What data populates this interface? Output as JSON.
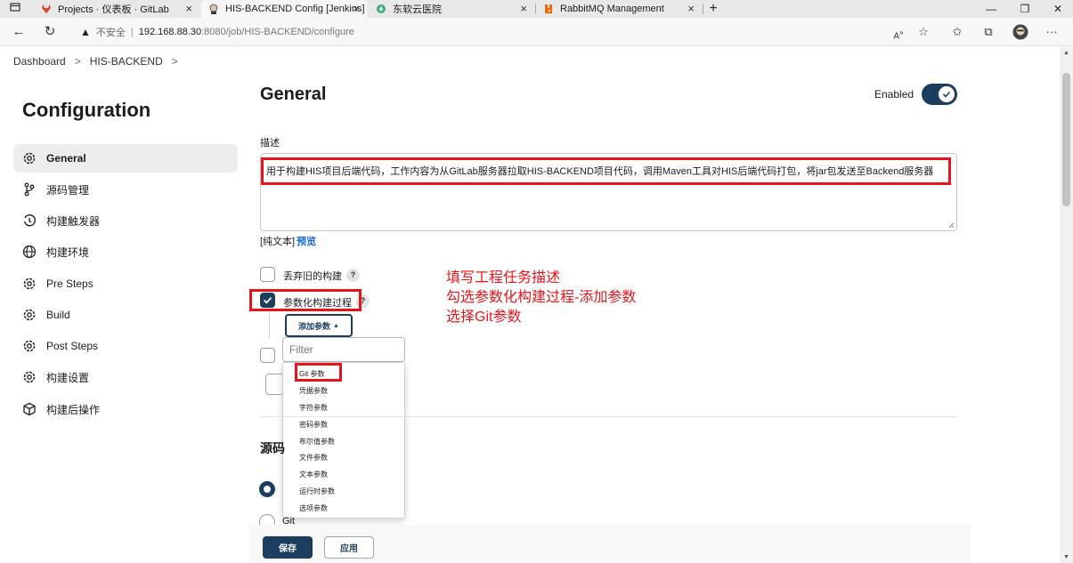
{
  "browser": {
    "tabs": [
      {
        "title": "Projects · 仪表板 · GitLab"
      },
      {
        "title": "HIS-BACKEND Config [Jenkins]"
      },
      {
        "title": "东软云医院"
      },
      {
        "title": "RabbitMQ Management"
      }
    ],
    "new_tab": "+",
    "window_controls": {
      "minimize": "—",
      "restore": "❐",
      "close": "✕"
    },
    "address": {
      "security_label": "不安全",
      "separator": "|",
      "host": "192.168.88.30",
      "path": ":8080/job/HIS-BACKEND/configure"
    }
  },
  "breadcrumb": {
    "items": [
      "Dashboard",
      "HIS-BACKEND"
    ],
    "chevron": ">"
  },
  "sidebar": {
    "title": "Configuration",
    "items": [
      {
        "label": "General",
        "icon": "gear-icon"
      },
      {
        "label": "源码管理",
        "icon": "branch-icon"
      },
      {
        "label": "构建触发器",
        "icon": "clock-icon"
      },
      {
        "label": "构建环境",
        "icon": "globe-icon"
      },
      {
        "label": "Pre Steps",
        "icon": "gear-icon"
      },
      {
        "label": "Build",
        "icon": "gear-icon"
      },
      {
        "label": "Post Steps",
        "icon": "gear-icon"
      },
      {
        "label": "构建设置",
        "icon": "gear-icon"
      },
      {
        "label": "构建后操作",
        "icon": "cube-icon"
      }
    ]
  },
  "main": {
    "title": "General",
    "enabled_label": "Enabled",
    "enabled": true,
    "description_label": "描述",
    "description_value": "用于构建HIS项目后端代码，工作内容为从GitLab服务器拉取HIS-BACKEND项目代码，调用Maven工具对HIS后端代码打包，将jar包发送至Backend服务器",
    "plain_text": "[纯文本]",
    "preview": "预览",
    "discard_old_builds": {
      "label": "丢弃旧的构建",
      "checked": false
    },
    "parameterized": {
      "label": "参数化构建过程",
      "checked": true
    },
    "help": "?",
    "add_param_button": "添加参数",
    "filter_placeholder": "Filter",
    "param_types": [
      "Git 参数",
      "凭据参数",
      "字符参数",
      "密码参数",
      "布尔值参数",
      "文件参数",
      "文本参数",
      "运行时参数",
      "选项参数"
    ],
    "source_title": "源码",
    "source_git": "Git",
    "save_button": "保存",
    "apply_button": "应用"
  },
  "annotation": {
    "lines": [
      "填写工程任务描述",
      "勾选参数化构建过程-添加参数",
      "选择Git参数"
    ]
  },
  "colors": {
    "accent": "#1c3e5e",
    "highlight": "#e8141c",
    "link": "#1669d3"
  }
}
